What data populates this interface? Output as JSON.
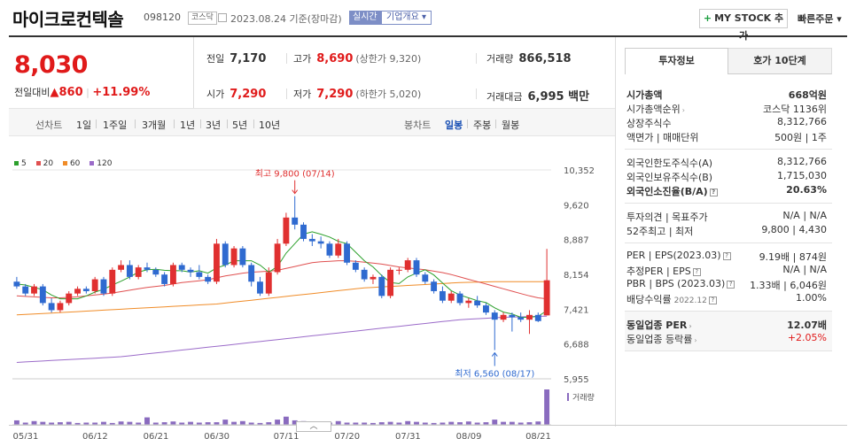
{
  "header": {
    "name": "마이크로컨텍솔",
    "code": "098120",
    "market": "코스닥",
    "date": "2023.08.24 기준(장마감)",
    "realtime": "실시간",
    "overview": "기업개요 ▾",
    "mystock": "MY STOCK 추가",
    "mystock_plus": "+",
    "quick": "빠른주문 ▾"
  },
  "price": {
    "current": "8,030",
    "change_label": "전일대비",
    "change": "▲860",
    "change_pct": "+11.99%"
  },
  "stats": {
    "prev_label": "전일",
    "prev": "7,170",
    "high_label": "고가",
    "high": "8,690",
    "high_limit": "(상한가 9,320)",
    "volume_label": "거래량",
    "volume": "866,518",
    "open_label": "시가",
    "open": "7,290",
    "low_label": "저가",
    "low": "7,290",
    "low_limit": "(하한가 5,020)",
    "amount_label": "거래대금",
    "amount": "6,995 백만"
  },
  "period": {
    "line_label": "선차트",
    "line_items": [
      "1일",
      "1주일",
      "3개월",
      "1년",
      "3년",
      "5년",
      "10년"
    ],
    "candle_label": "봉차트",
    "candle_items": [
      "일봉",
      "주봉",
      "월봉"
    ],
    "active": "일봉"
  },
  "legend": [
    {
      "label": "5",
      "color": "#2ca02c"
    },
    {
      "label": "20",
      "color": "#e05050"
    },
    {
      "label": "60",
      "color": "#f08c28"
    },
    {
      "label": "120",
      "color": "#9b6bc9"
    }
  ],
  "chart_data": {
    "type": "candlestick",
    "y_ticks": [
      "10,352",
      "9,620",
      "8,887",
      "8,154",
      "7,421",
      "6,688",
      "5,955"
    ],
    "ylim": [
      5955,
      10352
    ],
    "x_ticks": [
      "05/31",
      "06/12",
      "06/21",
      "06/30",
      "07/11",
      "07/20",
      "07/31",
      "08/09",
      "08/21"
    ],
    "annotations": {
      "high": "최고 9,800 (07/14)",
      "low": "최저 6,560 (08/17)"
    },
    "volume_label": "거래량",
    "up_color": "#e03030",
    "down_color": "#2f6ad0",
    "candles": [
      {
        "o": 8000,
        "h": 8100,
        "l": 7850,
        "c": 7900
      },
      {
        "o": 7900,
        "h": 7950,
        "l": 7700,
        "c": 7750
      },
      {
        "o": 7750,
        "h": 7950,
        "l": 7700,
        "c": 7900
      },
      {
        "o": 7900,
        "h": 7950,
        "l": 7500,
        "c": 7550
      },
      {
        "o": 7550,
        "h": 7650,
        "l": 7350,
        "c": 7400
      },
      {
        "o": 7400,
        "h": 7600,
        "l": 7350,
        "c": 7550
      },
      {
        "o": 7550,
        "h": 7800,
        "l": 7500,
        "c": 7750
      },
      {
        "o": 7750,
        "h": 7900,
        "l": 7700,
        "c": 7850
      },
      {
        "o": 7850,
        "h": 7900,
        "l": 7750,
        "c": 7800
      },
      {
        "o": 7800,
        "h": 8100,
        "l": 7750,
        "c": 8050
      },
      {
        "o": 8050,
        "h": 8100,
        "l": 7700,
        "c": 7750
      },
      {
        "o": 7750,
        "h": 8300,
        "l": 7700,
        "c": 8250
      },
      {
        "o": 8250,
        "h": 8450,
        "l": 8200,
        "c": 8350
      },
      {
        "o": 8350,
        "h": 8450,
        "l": 8050,
        "c": 8100
      },
      {
        "o": 8100,
        "h": 8350,
        "l": 8050,
        "c": 8300
      },
      {
        "o": 8300,
        "h": 8400,
        "l": 8200,
        "c": 8250
      },
      {
        "o": 8250,
        "h": 8300,
        "l": 8100,
        "c": 8150
      },
      {
        "o": 8150,
        "h": 8200,
        "l": 7900,
        "c": 7950
      },
      {
        "o": 7950,
        "h": 8400,
        "l": 7900,
        "c": 8350
      },
      {
        "o": 8350,
        "h": 8400,
        "l": 8200,
        "c": 8250
      },
      {
        "o": 8250,
        "h": 8300,
        "l": 8100,
        "c": 8200
      },
      {
        "o": 8200,
        "h": 8350,
        "l": 8050,
        "c": 8100
      },
      {
        "o": 8100,
        "h": 8150,
        "l": 7950,
        "c": 8000
      },
      {
        "o": 8000,
        "h": 8900,
        "l": 7950,
        "c": 8800
      },
      {
        "o": 8800,
        "h": 8850,
        "l": 8300,
        "c": 8350
      },
      {
        "o": 8350,
        "h": 8750,
        "l": 8300,
        "c": 8700
      },
      {
        "o": 8700,
        "h": 8750,
        "l": 8300,
        "c": 8350
      },
      {
        "o": 8350,
        "h": 8400,
        "l": 7900,
        "c": 8000
      },
      {
        "o": 8000,
        "h": 8100,
        "l": 7700,
        "c": 7750
      },
      {
        "o": 7750,
        "h": 8300,
        "l": 7700,
        "c": 8200
      },
      {
        "o": 8200,
        "h": 8900,
        "l": 8150,
        "c": 8800
      },
      {
        "o": 8800,
        "h": 9450,
        "l": 8750,
        "c": 9350
      },
      {
        "o": 9350,
        "h": 9800,
        "l": 9100,
        "c": 9200
      },
      {
        "o": 9200,
        "h": 9250,
        "l": 8850,
        "c": 8900
      },
      {
        "o": 8900,
        "h": 9000,
        "l": 8750,
        "c": 8850
      },
      {
        "o": 8850,
        "h": 8950,
        "l": 8700,
        "c": 8800
      },
      {
        "o": 8800,
        "h": 8850,
        "l": 8500,
        "c": 8550
      },
      {
        "o": 8550,
        "h": 8900,
        "l": 8500,
        "c": 8800
      },
      {
        "o": 8800,
        "h": 8850,
        "l": 8350,
        "c": 8400
      },
      {
        "o": 8400,
        "h": 8450,
        "l": 8200,
        "c": 8250
      },
      {
        "o": 8250,
        "h": 8300,
        "l": 8000,
        "c": 8050
      },
      {
        "o": 8050,
        "h": 8150,
        "l": 7950,
        "c": 8100
      },
      {
        "o": 8100,
        "h": 8150,
        "l": 7650,
        "c": 7700
      },
      {
        "o": 7700,
        "h": 8300,
        "l": 7650,
        "c": 8250
      },
      {
        "o": 8250,
        "h": 8300,
        "l": 8150,
        "c": 8250
      },
      {
        "o": 8250,
        "h": 8500,
        "l": 8200,
        "c": 8450
      },
      {
        "o": 8450,
        "h": 8500,
        "l": 8100,
        "c": 8150
      },
      {
        "o": 8150,
        "h": 8200,
        "l": 7950,
        "c": 8000
      },
      {
        "o": 8000,
        "h": 8050,
        "l": 7750,
        "c": 7800
      },
      {
        "o": 7800,
        "h": 7900,
        "l": 7550,
        "c": 7600
      },
      {
        "o": 7600,
        "h": 7800,
        "l": 7550,
        "c": 7750
      },
      {
        "o": 7750,
        "h": 7800,
        "l": 7500,
        "c": 7550
      },
      {
        "o": 7550,
        "h": 7650,
        "l": 7450,
        "c": 7600
      },
      {
        "o": 7600,
        "h": 7700,
        "l": 7450,
        "c": 7500
      },
      {
        "o": 7500,
        "h": 7550,
        "l": 7300,
        "c": 7350
      },
      {
        "o": 7350,
        "h": 7400,
        "l": 6560,
        "c": 7200
      },
      {
        "o": 7200,
        "h": 7350,
        "l": 7150,
        "c": 7300
      },
      {
        "o": 7300,
        "h": 7350,
        "l": 6950,
        "c": 7250
      },
      {
        "o": 7250,
        "h": 7350,
        "l": 7150,
        "c": 7200
      },
      {
        "o": 7200,
        "h": 7400,
        "l": 6900,
        "c": 7300
      },
      {
        "o": 7300,
        "h": 7350,
        "l": 7150,
        "c": 7170
      },
      {
        "o": 7290,
        "h": 8690,
        "l": 7290,
        "c": 8030
      }
    ],
    "ma5": [
      7950,
      7930,
      7880,
      7830,
      7720,
      7640,
      7640,
      7640,
      7700,
      7780,
      7840,
      7930,
      8010,
      8100,
      8200,
      8250,
      8260,
      8240,
      8230,
      8230,
      8200,
      8230,
      8180,
      8290,
      8350,
      8440,
      8440,
      8440,
      8350,
      8200,
      8320,
      8600,
      8800,
      9000,
      9050,
      9000,
      8940,
      8850,
      8800,
      8620,
      8440,
      8310,
      8130,
      7980,
      7960,
      8100,
      8180,
      8250,
      8140,
      7970,
      7810,
      7720,
      7660,
      7600,
      7560,
      7450,
      7360,
      7320,
      7250,
      7250,
      7270,
      7390
    ],
    "ma20": [
      7700,
      7690,
      7680,
      7670,
      7660,
      7660,
      7670,
      7680,
      7700,
      7720,
      7740,
      7760,
      7790,
      7820,
      7850,
      7880,
      7900,
      7920,
      7950,
      7980,
      8000,
      8020,
      8040,
      8080,
      8120,
      8150,
      8180,
      8200,
      8210,
      8220,
      8240,
      8280,
      8320,
      8360,
      8400,
      8420,
      8430,
      8440,
      8440,
      8430,
      8410,
      8390,
      8370,
      8340,
      8310,
      8290,
      8270,
      8250,
      8220,
      8190,
      8150,
      8100,
      8050,
      8000,
      7950,
      7900,
      7850,
      7800,
      7750,
      7700,
      7660,
      7640
    ],
    "ma60": [
      7300,
      7310,
      7320,
      7330,
      7340,
      7350,
      7360,
      7370,
      7380,
      7390,
      7400,
      7410,
      7420,
      7430,
      7440,
      7450,
      7460,
      7470,
      7480,
      7490,
      7500,
      7510,
      7520,
      7530,
      7550,
      7570,
      7590,
      7610,
      7630,
      7650,
      7670,
      7690,
      7710,
      7730,
      7750,
      7770,
      7790,
      7810,
      7830,
      7850,
      7870,
      7880,
      7890,
      7900,
      7910,
      7920,
      7930,
      7940,
      7950,
      7960,
      7970,
      7980,
      7985,
      7990,
      7995,
      8000,
      8000,
      8000,
      8000,
      8000,
      8000,
      8000
    ],
    "ma120": [
      6300,
      6310,
      6320,
      6330,
      6340,
      6350,
      6360,
      6370,
      6380,
      6390,
      6400,
      6410,
      6420,
      6440,
      6460,
      6480,
      6500,
      6520,
      6540,
      6560,
      6580,
      6600,
      6620,
      6640,
      6660,
      6680,
      6700,
      6720,
      6740,
      6760,
      6780,
      6800,
      6820,
      6840,
      6860,
      6880,
      6900,
      6920,
      6940,
      6960,
      6980,
      7000,
      7020,
      7040,
      7060,
      7080,
      7100,
      7120,
      7140,
      7160,
      7180,
      7200,
      7210,
      7220,
      7230,
      7240,
      7250,
      7255,
      7260,
      7265,
      7270,
      7275
    ],
    "volume": [
      12,
      6,
      10,
      8,
      6,
      7,
      8,
      5,
      6,
      6,
      8,
      5,
      9,
      8,
      6,
      20,
      6,
      7,
      9,
      6,
      8,
      6,
      7,
      7,
      14,
      8,
      10,
      6,
      5,
      7,
      14,
      22,
      12,
      10,
      8,
      8,
      6,
      10,
      6,
      6,
      6,
      5,
      7,
      8,
      6,
      10,
      8,
      6,
      5,
      6,
      8,
      7,
      9,
      6,
      7,
      14,
      8,
      8,
      6,
      7,
      9,
      95
    ]
  },
  "tabs": [
    "투자정보",
    "호가 10단계"
  ],
  "info": {
    "g1": [
      {
        "l": "시가총액",
        "r": "668억원",
        "bold": true
      },
      {
        "l": "시가총액순위",
        "r": "코스닥 1136위",
        "arrow": true
      },
      {
        "l": "상장주식수",
        "r": "8,312,766"
      },
      {
        "l": "액면가 | 매매단위",
        "r": "500원 | 1주"
      }
    ],
    "g2": [
      {
        "l": "외국인한도주식수(A)",
        "r": "8,312,766"
      },
      {
        "l": "외국인보유주식수(B)",
        "r": "1,715,030"
      },
      {
        "l": "외국인소진율(B/A)",
        "r": "20.63%",
        "bold": true,
        "q": true
      }
    ],
    "g3": [
      {
        "l": "투자의견 | 목표주가",
        "r": "N/A | N/A"
      },
      {
        "l": "52주최고 | 최저",
        "r": "9,800 | 4,430"
      }
    ],
    "g4": [
      {
        "l": "PER | EPS(2023.03)",
        "r": "9.19배 | 874원",
        "q": true
      },
      {
        "l": "추정PER | EPS",
        "r": "N/A | N/A",
        "q": true
      },
      {
        "l": "PBR | BPS (2023.03)",
        "r": "1.33배 | 6,046원",
        "q": true
      },
      {
        "l": "배당수익률",
        "sub": "2022.12",
        "r": "1.00%",
        "q": true
      }
    ],
    "g5": [
      {
        "l": "동일업종 PER",
        "r": "12.07배",
        "bold": true,
        "arrow": true
      },
      {
        "l": "동일업종 등락률",
        "r": "+2.05%",
        "red": true,
        "arrow": true
      }
    ]
  },
  "toggle": "︿"
}
